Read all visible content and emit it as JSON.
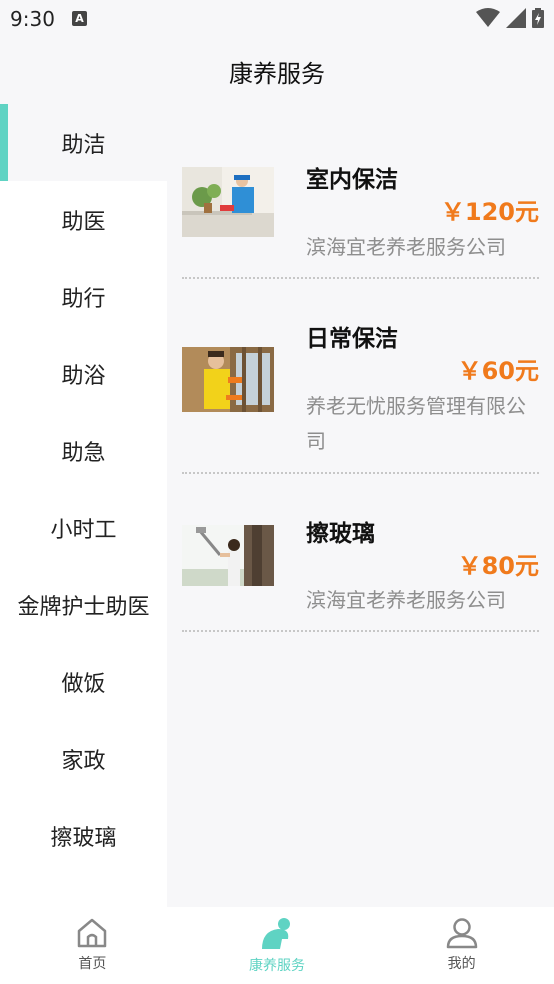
{
  "status": {
    "time": "9:30",
    "notification_letter": "A"
  },
  "header": {
    "title": "康养服务"
  },
  "sidebar": {
    "items": [
      {
        "label": "助洁",
        "active": true
      },
      {
        "label": "助医"
      },
      {
        "label": "助行"
      },
      {
        "label": "助浴"
      },
      {
        "label": "助急"
      },
      {
        "label": "小时工"
      },
      {
        "label": "金牌护士助医"
      },
      {
        "label": "做饭"
      },
      {
        "label": "家政"
      },
      {
        "label": "擦玻璃"
      }
    ]
  },
  "services": [
    {
      "title": "室内保洁",
      "price": "￥120元",
      "vendor": "滨海宜老养老服务公司"
    },
    {
      "title": "日常保洁",
      "price": "￥60元",
      "vendor": "养老无忧服务管理有限公司"
    },
    {
      "title": "擦玻璃",
      "price": "￥80元",
      "vendor": "滨海宜老养老服务公司"
    }
  ],
  "tabbar": {
    "home": "首页",
    "service": "康养服务",
    "mine": "我的"
  },
  "colors": {
    "accent": "#5fd3c3",
    "price": "#f07a1c"
  }
}
